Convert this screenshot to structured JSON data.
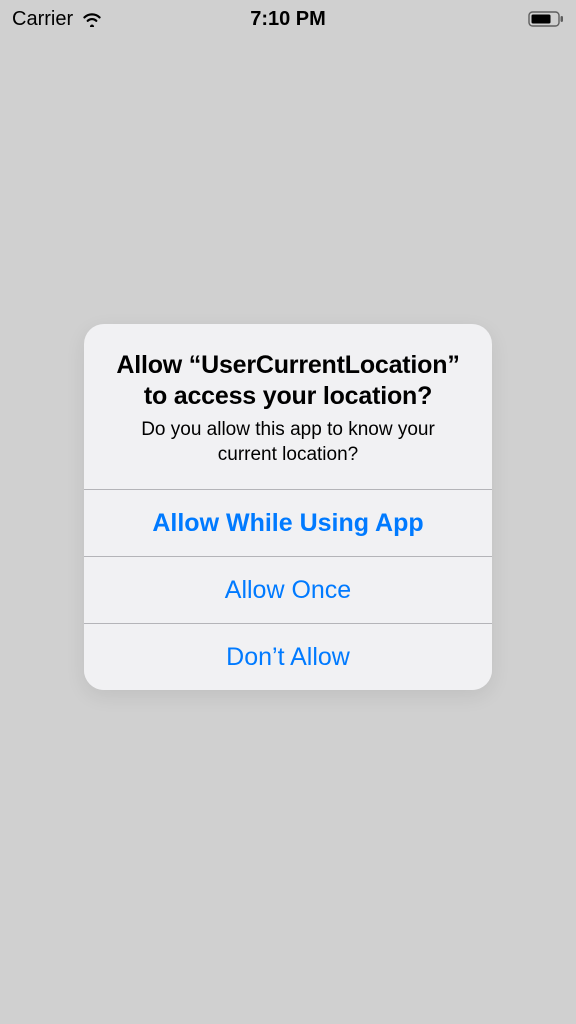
{
  "status_bar": {
    "carrier": "Carrier",
    "time": "7:10 PM"
  },
  "dialog": {
    "title": "Allow “UserCurrentLocation” to access your location?",
    "message": "Do you allow this app to know your current location?",
    "buttons": {
      "allow_while_using": "Allow While Using App",
      "allow_once": "Allow Once",
      "dont_allow": "Don’t Allow"
    }
  },
  "colors": {
    "accent": "#007aff",
    "dialog_bg": "#f1f1f3",
    "page_bg": "#d0d0d0"
  }
}
